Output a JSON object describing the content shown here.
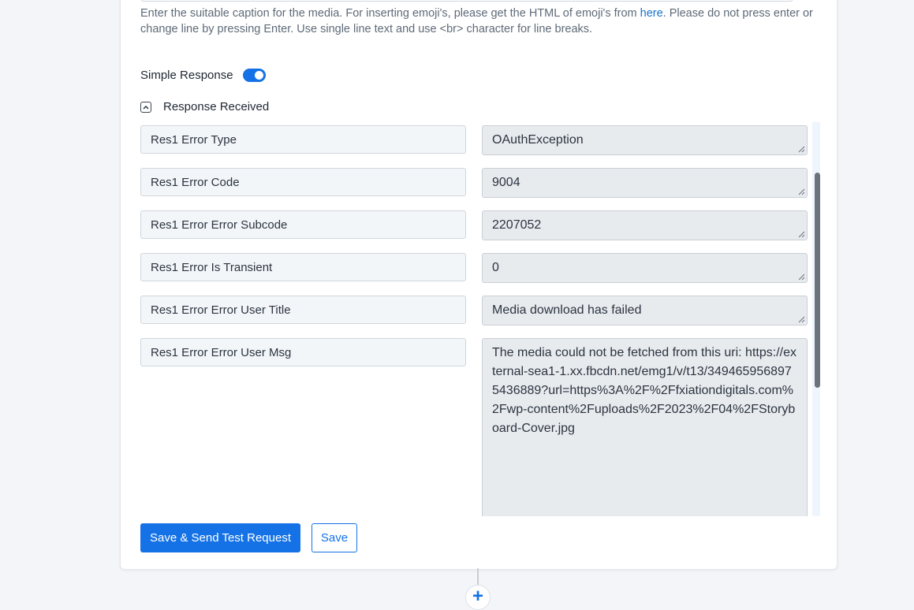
{
  "help": {
    "text_before_link": "Enter the suitable caption for the media. For inserting emoji's, please get the HTML of emoji's from ",
    "link_text": "here",
    "text_after_link": ". Please do not press enter or change line by pressing Enter. Use single line text and use <br> character for line breaks."
  },
  "simple_response": {
    "label": "Simple Response",
    "enabled": true
  },
  "response_section": {
    "title": "Response Received",
    "collapse_icon": "chevron-up-icon"
  },
  "fields": [
    {
      "key": "Res1 Error Type",
      "value": "OAuthException"
    },
    {
      "key": "Res1 Error Code",
      "value": "9004"
    },
    {
      "key": "Res1 Error Error Subcode",
      "value": "2207052"
    },
    {
      "key": "Res1 Error Is Transient",
      "value": "0"
    },
    {
      "key": "Res1 Error Error User Title",
      "value": "Media download has failed"
    },
    {
      "key": "Res1 Error Error User Msg",
      "value": "The media could not be fetched from this uri: https://external-sea1-1.xx.fbcdn.net/emg1/v/t13/3494659568975436889?url=https%3A%2F%2Ffxiationdigitals.com%2Fwp-content%2Fuploads%2F2023%2F04%2FStoryboard-Cover.jpg"
    }
  ],
  "buttons": {
    "save_and_send": "Save & Send Test Request",
    "save": "Save"
  },
  "add_step": {
    "icon": "plus-icon",
    "glyph": "+"
  },
  "colors": {
    "accent": "#1472e6",
    "page_bg": "#f3f5f8",
    "value_bg": "#e8ebee",
    "key_bg": "#f3f6f9"
  }
}
